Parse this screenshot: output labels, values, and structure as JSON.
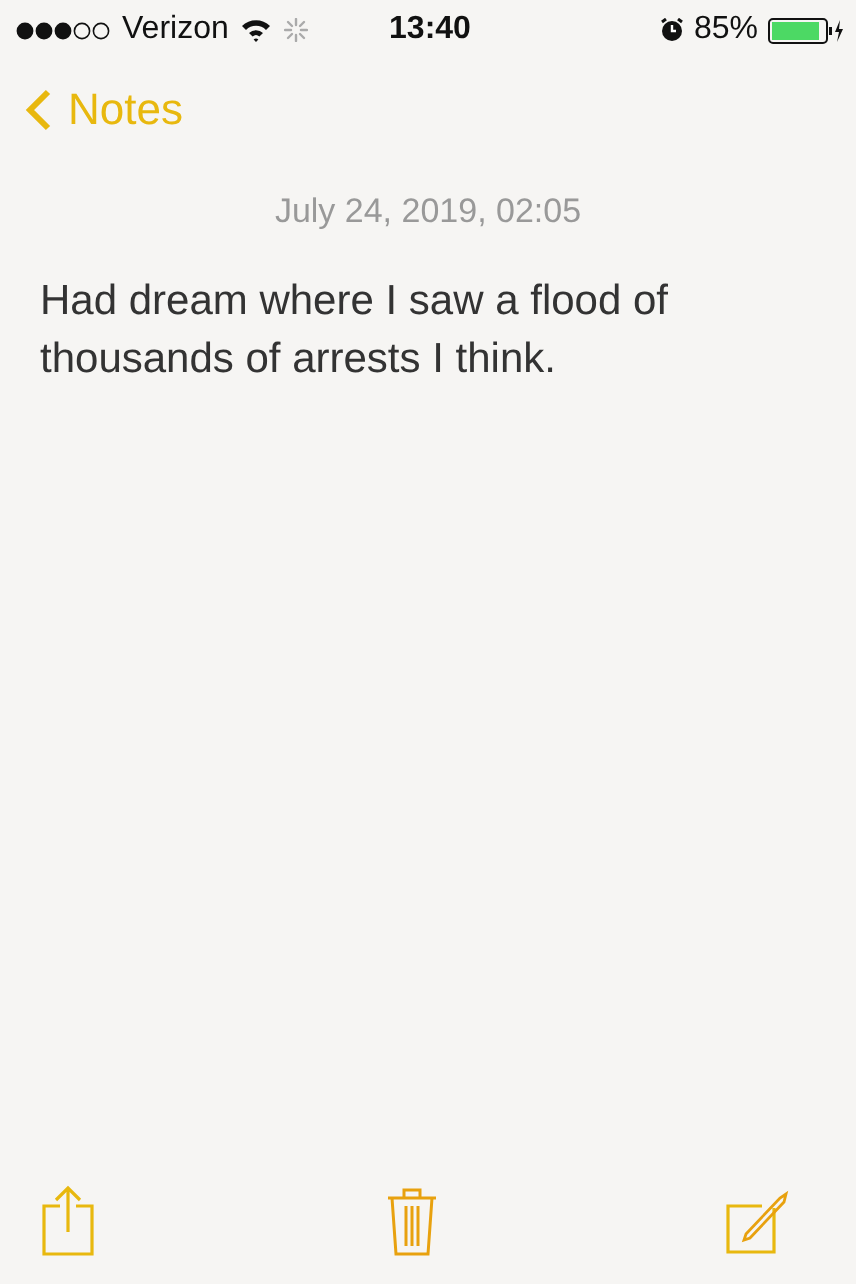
{
  "status_bar": {
    "carrier": "Verizon",
    "time": "13:40",
    "battery": "85%"
  },
  "nav": {
    "back": "Notes"
  },
  "note": {
    "date": "July 24, 2019, 02:05",
    "body": "Had dream where I saw a flood of thousands of arrests I think."
  }
}
